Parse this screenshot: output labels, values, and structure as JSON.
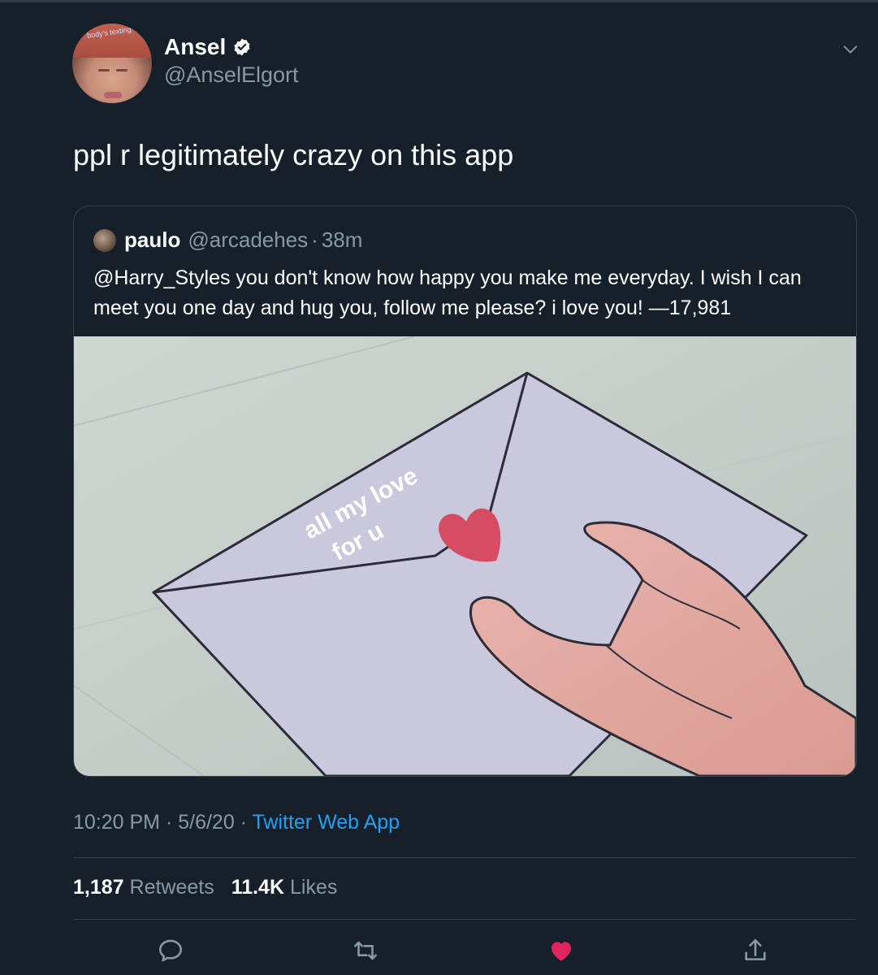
{
  "tweet": {
    "author": {
      "display_name": "Ansel",
      "handle": "@AnselElgort",
      "verified": true,
      "avatar_caption": "body's texting"
    },
    "text": "ppl r legitimately crazy on this app",
    "quoted": {
      "display_name": "paulo",
      "handle": "@arcadehes",
      "separator": "·",
      "time": "38m",
      "text": "@Harry_Styles you don't know how happy you make me everyday. I wish I can meet you one day and hug you, follow me please? i love you! —17,981",
      "image_text_line1": "all my love",
      "image_text_line2": "for u"
    },
    "meta": {
      "time": "10:20 PM",
      "sep1": " · ",
      "date": "5/6/20",
      "sep2": " · ",
      "source": "Twitter Web App"
    },
    "stats": {
      "retweets_count": "1,187",
      "retweets_label": "Retweets",
      "likes_count": "11.4K",
      "likes_label": "Likes"
    },
    "actions": {
      "reply_icon": "reply-icon",
      "retweet_icon": "retweet-icon",
      "like_icon": "heart-icon",
      "share_icon": "share-icon"
    }
  },
  "colors": {
    "background": "#15202b",
    "text_secondary": "#8899a6",
    "link": "#1da1f2",
    "like": "#e0245e",
    "border": "#38444d"
  }
}
